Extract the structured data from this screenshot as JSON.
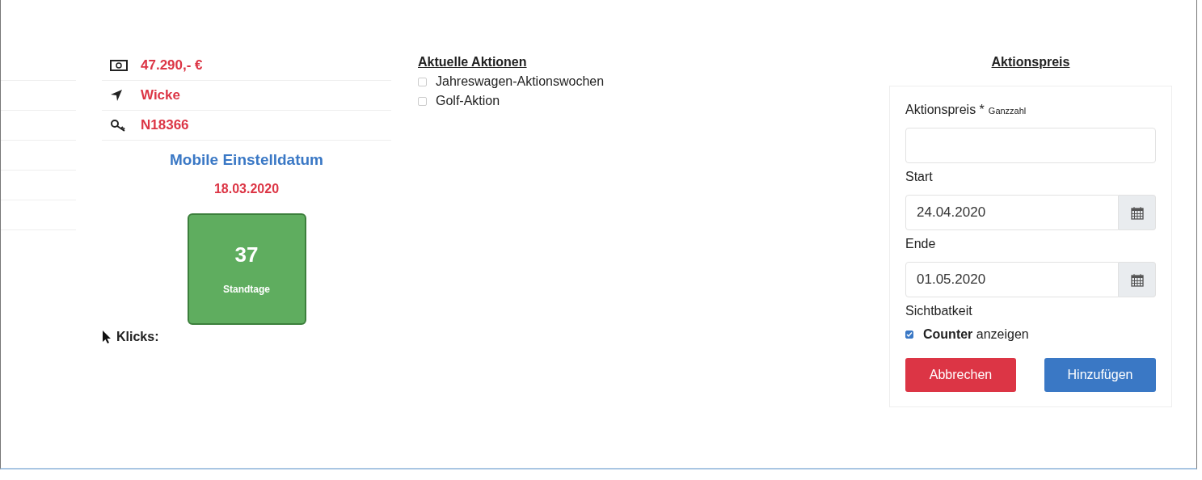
{
  "info_rows": [
    {
      "kind": "price",
      "value": "47.290,- €"
    },
    {
      "kind": "location",
      "value": "Wicke"
    },
    {
      "kind": "key",
      "value": "N18366"
    }
  ],
  "online_date": {
    "label": "Mobile Einstelldatum",
    "date": "18.03.2020"
  },
  "days_tile": {
    "count": "37",
    "label": "Standtage"
  },
  "clicks": {
    "label": "Klicks:"
  },
  "promotions": {
    "title": "Aktuelle Aktionen",
    "items": [
      {
        "label": "Jahreswagen-Aktionswochen",
        "checked": false
      },
      {
        "label": "Golf-Aktion",
        "checked": false
      }
    ]
  },
  "price_form": {
    "title": "Aktionspreis",
    "price_label": "Aktionspreis *",
    "price_hint": "Ganzzahl",
    "start_label": "Start",
    "start_value": "24.04.2020",
    "end_label": "Ende",
    "end_value": "01.05.2020",
    "visibility_label": "Sichtbatkeit",
    "counter": {
      "label": "**Counter** anzeigen",
      "checked": true
    },
    "buttons": [
      {
        "kind": "cancel",
        "label": "Abbrechen"
      },
      {
        "kind": "submit",
        "label": "Hinzufügen"
      }
    ]
  }
}
